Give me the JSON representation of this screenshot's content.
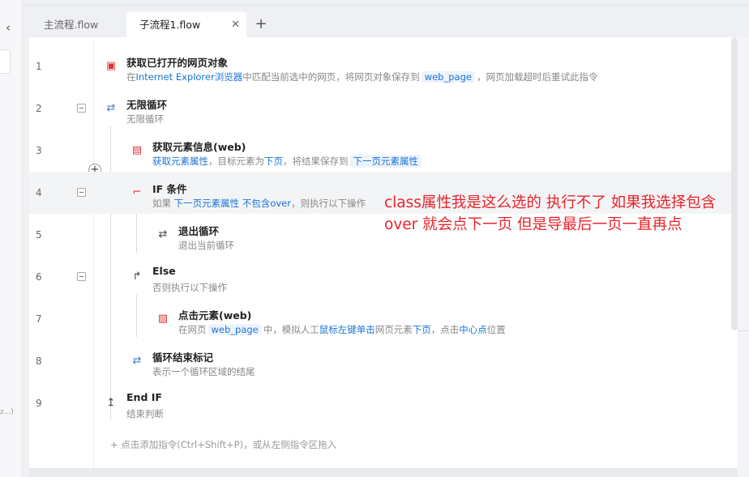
{
  "sidebar": {
    "collapse_glyph": "‹",
    "truncated_text": "z...)"
  },
  "tabs": [
    {
      "label": "主流程.flow",
      "active": false
    },
    {
      "label": "子流程1.flow",
      "active": true,
      "close_glyph": "✕"
    }
  ],
  "tab_add_glyph": "+",
  "add_glyph": "+",
  "commands": [
    {
      "line": "1",
      "title": "获取已打开的网页对象",
      "icon": "browser-icon",
      "desc": {
        "a": "在",
        "b": "Internet Explorer浏览器",
        "c": "中匹配当前选中的网页，将网页对象保存到",
        "d": "web_page",
        "e": "，网页加载超时后重试此指令"
      }
    },
    {
      "line": "2",
      "title": "无限循环",
      "icon": "loop-icon",
      "desc_text": "无限循环"
    },
    {
      "line": "3",
      "title": "获取元素信息(web)",
      "icon": "element-info-icon",
      "desc": {
        "a": "获取元素属性",
        "b": "，目标元素为",
        "c": "下页",
        "d": "，将结果保存到",
        "e": "下一页元素属性"
      }
    },
    {
      "line": "4",
      "title": "IF 条件",
      "icon": "if-icon",
      "desc": {
        "a": "如果",
        "b": "下一页元素属性",
        "c": "不包含",
        "d": "over",
        "e": "，则执行以下操作"
      }
    },
    {
      "line": "5",
      "title": "退出循环",
      "icon": "exit-loop-icon",
      "desc_text": "退出当前循环"
    },
    {
      "line": "6",
      "title": "Else",
      "icon": "else-icon",
      "desc_text": "否则执行以下操作"
    },
    {
      "line": "7",
      "title": "点击元素(web)",
      "icon": "click-element-icon",
      "desc": {
        "a": "在网页",
        "b": "web_page",
        "c": "中，模拟人工",
        "d": "鼠标左键单击",
        "e": "网页元素",
        "f": "下页",
        "g": "，点击",
        "h": "中心点",
        "i": "位置"
      }
    },
    {
      "line": "8",
      "title": "循环结束标记",
      "icon": "loop-end-icon",
      "desc_text": "表示一个循环区域的结尾"
    },
    {
      "line": "9",
      "title": "End IF",
      "icon": "end-if-icon",
      "desc_text": "结束判断"
    }
  ],
  "add_hint": "+ 点击添加指令(Ctrl+Shift+P)，或从左侧指令区拖入",
  "annotation": "class属性我是这么选的 执行不了 如果我选择包含over 就会点下一页 但是导最后一页一直再点"
}
